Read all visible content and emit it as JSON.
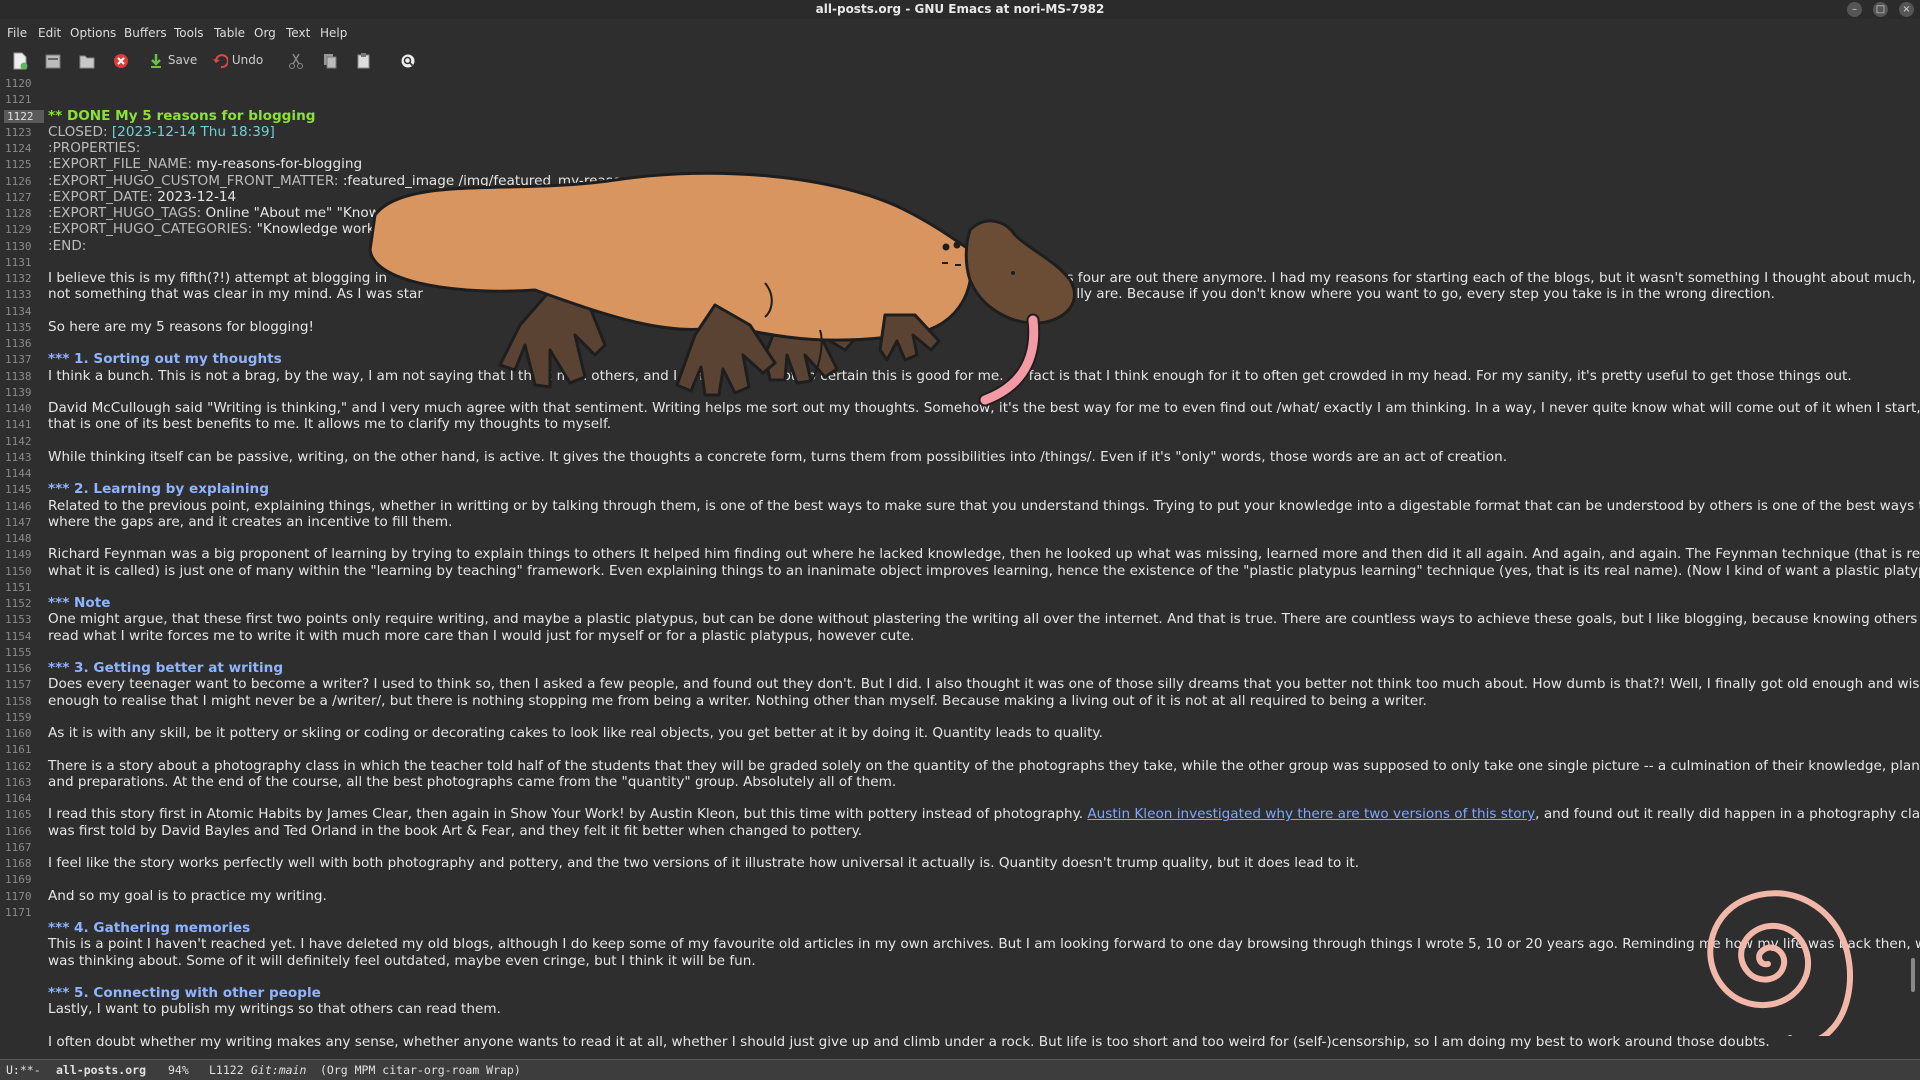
{
  "window": {
    "title": "all-posts.org - GNU Emacs at nori-MS-7982"
  },
  "menu": [
    "File",
    "Edit",
    "Options",
    "Buffers",
    "Tools",
    "Table",
    "Org",
    "Text",
    "Help"
  ],
  "toolbar": {
    "save_label": "Save",
    "undo_label": "Undo"
  },
  "gutter": {
    "line_numbers": [
      "1120",
      "1121",
      "1122",
      "1123",
      "1124",
      "1125",
      "1126",
      "1127",
      "1128",
      "1129",
      "1130",
      "1131",
      "1132",
      "1133",
      "1134",
      "1135",
      "1136",
      "1137",
      "1138",
      "1139",
      "1140",
      "1141",
      "1142",
      "1143",
      "1144",
      "1145",
      "1146",
      "1147",
      "1148",
      "1149",
      "1150",
      "1151",
      "1152",
      "1153",
      "1154",
      "1155",
      "1156",
      "1157",
      "1158",
      "1159",
      "1160",
      "1161",
      "1162",
      "1163",
      "1164",
      "1165",
      "1166",
      "1167",
      "1168",
      "1169",
      "1170",
      "1171"
    ],
    "current": "1122"
  },
  "buffer": {
    "heading_main": "** DONE My 5 reasons for blogging",
    "closed_key": "CLOSED: ",
    "closed_value": "[2023-12-14 Thu 18:39]",
    "properties": ":PROPERTIES:",
    "export_file_name_key": ":EXPORT_FILE_NAME: ",
    "export_file_name_value": "my-reasons-for-blogging",
    "front_matter_key": ":EXPORT_HUGO_CUSTOM_FRONT_MATTER: ",
    "front_matter_value": ":featured_image /img/featured_my-reasons",
    "export_date_key": ":EXPORT_DATE: ",
    "export_date_value": "2023-12-14",
    "tags_key": ":EXPORT_HUGO_TAGS: ",
    "tags_value": "Online \"About me\" \"Knowle",
    "categories_key": ":EXPORT_HUGO_CATEGORIES: ",
    "categories_value": "\"Knowledge work\"",
    "end": ":END:",
    "p1_a": "I believe this is my fifth(?!) attempt at blogging in",
    "p1_b": "revious four are out there anymore. I had my reasons for starting each of the blogs, but it wasn't something I thought about much,",
    "p1_c": "not something that was clear in my mind. As I was star",
    "p1_d": "ally are. Because if you don't know where you want to go, every step you take is in the wrong direction.",
    "p2": "So here are my 5 reasons for blogging!",
    "h_sorting": "*** 1. Sorting out my thoughts",
    "p3_a": "I think a bunch. This is not a brag, by the way, I am not saying that I think m",
    "p3_b": "an others, and I am c",
    "p3_c": "not so certain this is good for me.",
    "p3_d": "e fact is that I think enough for it to often get crowded in my head. For my sanity, it's pretty useful to get those things out.",
    "p4_a": "David McCullough said \"Writing is thinking,\" and I very much agree with that sentiment. Writing helps me sort out my thoughts. Somehow, it's the best way for me to even find out /what/ exactly I am thinking. In a way, I never quite know what will come out of it when I start, but",
    "p4_b": "that is one of its best benefits to me. It allows me to clarify my thoughts to myself.",
    "p5": "While thinking itself can be passive, writing, on the other hand, is active. It gives the thoughts a concrete form, turns them from possibilities into /things/. Even if it's \"only\" words, those words are an act of creation.",
    "h_learning": "*** 2. Learning by explaining",
    "p6_a": "Related to the previous point, explaining things, whether in writting or by talking through them, is one of the best ways to make sure that you understand things. Trying to put your knowledge into a digestable format that can be understood by others is one of the best ways to see",
    "p6_b": "where the gaps are, and it creates an incentive to fill them.",
    "p7_a": "Richard Feynman was a big proponent of learning by trying to explain things to others It helped him finding out where he lacked knowledge, then he looked up what was missing, learned more and then did it all again. And again, and again. The Feynman technique (that is really",
    "p7_b": "what it is called) is just one of many within the \"learning by teaching\" framework. Even explaining things to an inanimate object improves learning, hence the existence of the \"plastic platypus learning\" technique (yes, that is its real name). (Now I kind of want a plastic platypus.)",
    "h_note": "*** Note",
    "p8_a": "One might argue, that these first two points only require writing, and maybe a plastic platypus, but can be done without plastering the writing all over the internet. And that is true. There are countless ways to achieve these goals, but I like blogging, because knowing others might",
    "p8_b": "read what I write forces me to write it with much more care than I would just for myself or for a plastic platypus, however cute.",
    "h_getting": "*** 3. Getting better at writing",
    "p9_a": "Does every teenager want to become a writer? I used to think so, then I asked a few people, and found out they don't. But I did. I also thought it was one of those silly dreams that you better not think too much about. How dumb is that?! Well, I finally got old enough and wise",
    "p9_b": "enough to realise that I might never be a /writer/, but there is nothing stopping me from being a writer. Nothing other than myself. Because making a living out of it is not at all required to being a writer.",
    "p10": "As it is with any skill, be it pottery or skiing or coding or decorating cakes to look like real objects, you get better at it by doing it. Quantity leads to quality.",
    "p11_a": "There is a story about a photography class in which the teacher told half of the students that they will be graded solely on the quantity of the photographs they take, while the other group was supposed to only take one single picture -- a culmination of their knowledge, planning",
    "p11_b": "and preparations. At the end of the course, all the best photographs came from the \"quantity\" group. Absolutely all of them.",
    "p12_a": "I read this story first in Atomic Habits by James Clear, then again in Show Your Work! by Austin Kleon, but this time with pottery instead of photography. ",
    "p12_link": "Austin Kleon investigated why there are two versions of this story",
    "p12_b": ", and found out it really did happen in a photography class, but",
    "p12_c": "was first told by David Bayles and Ted Orland in the book Art & Fear, and they felt it fit better when changed to pottery.",
    "p13": "I feel like the story works perfectly well with both photography and pottery, and the two versions of it illustrate how universal it actually is. Quantity doesn't trump quality, but it does lead to it.",
    "p14": "And so my goal is to practice my writing.",
    "h_memories": "*** 4. Gathering memories",
    "p15_a": "This is a point I haven't reached yet. I have deleted my old blogs, although I do keep some of my favourite old articles in my own archives. But I am looking forward to one day browsing through things I wrote 5, 10 or 20 years ago. Reminding me how my life was back then, what I",
    "p15_b": "was thinking about. Some of it will definitely feel outdated, maybe even cringe, but I think it will be fun.",
    "h_connecting": "*** 5. Connecting with other people",
    "p16": "Lastly, I want to publish my writings so that others can read them.",
    "p17": "I often doubt whether my writing makes any sense, whether anyone wants to read it at all, whether I should just give up and climb under a rock. But life is too short and too weird for (self-)censorship, so I am doing my best to work around those doubts."
  },
  "modeline": {
    "state": "U:**-",
    "buffer_name": "all-posts.org",
    "percent": "94%",
    "line": "L1122",
    "vc": "Git:main",
    "modes": "(Org MPM citar-org-roam Wrap)"
  },
  "colors": {
    "background": "#2e2e2e",
    "heading2": "#8ae234",
    "heading3": "#8fb4ff",
    "date": "#6ed1d9",
    "link": "#7ea7ff",
    "platypus_body": "#d9955f",
    "spiral": "#f2b7a8"
  },
  "icons": [
    "new-file-icon",
    "open-file-icon",
    "folder-icon",
    "close-buffer-icon",
    "save-icon",
    "undo-icon",
    "cut-icon",
    "copy-icon",
    "paste-icon",
    "search-icon",
    "platypus-illustration",
    "spiral-illustration"
  ]
}
